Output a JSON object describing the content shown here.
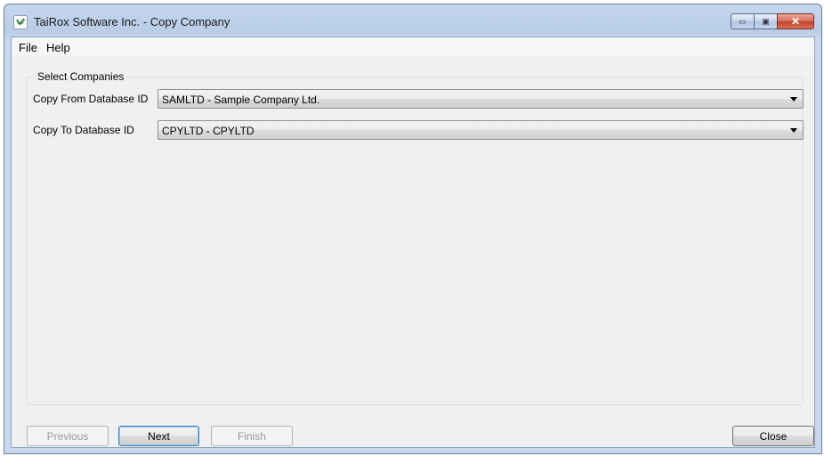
{
  "window": {
    "title": "TaiRox Software Inc. - Copy Company",
    "app_icon": "tairox-logo-icon",
    "caption_buttons": {
      "minimize": "minimize-icon",
      "maximize": "maximize-icon",
      "close": "close-icon",
      "minimize_glyph": "▭",
      "maximize_glyph": "▣",
      "close_glyph": "✕"
    }
  },
  "menu": {
    "items": [
      {
        "label": "File"
      },
      {
        "label": "Help"
      }
    ]
  },
  "select_companies": {
    "title": "Select Companies",
    "copy_from": {
      "label": "Copy From Database ID",
      "value": "SAMLTD - Sample Company Ltd."
    },
    "copy_to": {
      "label": "Copy To Database ID",
      "value": "CPYLTD - CPYLTD"
    }
  },
  "buttons": {
    "previous": {
      "label": "Previous",
      "enabled": false
    },
    "next": {
      "label": "Next",
      "enabled": true
    },
    "finish": {
      "label": "Finish",
      "enabled": false
    },
    "close": {
      "label": "Close",
      "enabled": true
    }
  },
  "colors": {
    "title_bar": "#b9cde6",
    "client_background": "#f0f0f0",
    "close_button": "#c44128",
    "logo_green": "#3aa04a"
  }
}
